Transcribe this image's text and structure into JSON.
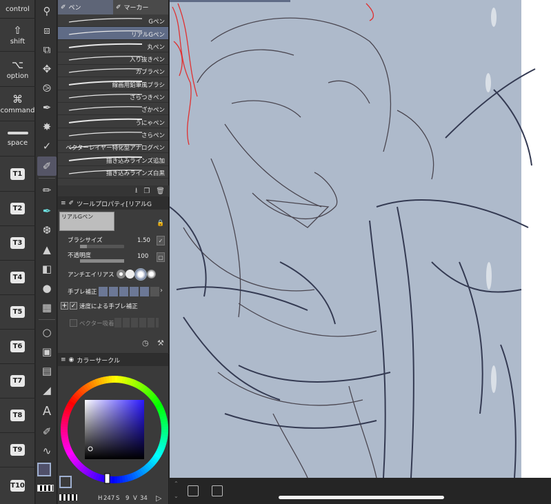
{
  "modifiers": [
    {
      "label": "control",
      "symbol": ""
    },
    {
      "label": "shift",
      "symbol": "⇧"
    },
    {
      "label": "option",
      "symbol": "⌥"
    },
    {
      "label": "command",
      "symbol": "⌘"
    },
    {
      "label": "space",
      "symbol": ""
    }
  ],
  "t_keys": [
    "T1",
    "T2",
    "T3",
    "T4",
    "T5",
    "T6",
    "T7",
    "T8",
    "T9",
    "T10"
  ],
  "subtool": {
    "tabs": [
      "ペン",
      "マーカー"
    ],
    "brushes": [
      "Gペン",
      "リアルGペン",
      "丸ペン",
      "入り抜きペン",
      "カブラペン",
      "線画用鉛筆風ブラシ",
      "ざらつきペン",
      "ざかペン",
      "うにゃペン",
      "さらペン",
      "ベクターレイヤー特化型アナログペン",
      "描き込みラインズ追加",
      "描き込みラインズ白黒"
    ],
    "selected_index": 1
  },
  "tool_property": {
    "title": "ツールプロパティ[リアルG",
    "preview_name": "リアルGペン",
    "brush_size_label": "ブラシサイズ",
    "brush_size_value": "1.50",
    "brush_size_fraction": 0.15,
    "opacity_label": "不透明度",
    "opacity_value": "100",
    "opacity_fraction": 1.0,
    "antialias_label": "アンチエイリアス",
    "stabilization_label": "手ブレ補正",
    "speed_stab_label": "速度による手ブレ補正",
    "speed_stab_checked": "✓",
    "vector_snap_label": "ベクター吸着"
  },
  "color_panel": {
    "title": "カラーサークル",
    "h_label": "H",
    "h_value": "247",
    "s_label": "S",
    "s_value": "9",
    "v_label": "V",
    "v_value": "34",
    "main_color": "#50506a",
    "sub_color": "transparent"
  },
  "colors": {
    "canvas_bg": "#aebacb",
    "line_dark": "#343a52",
    "line_red": "#e03030",
    "accent": "#5f6b86"
  }
}
